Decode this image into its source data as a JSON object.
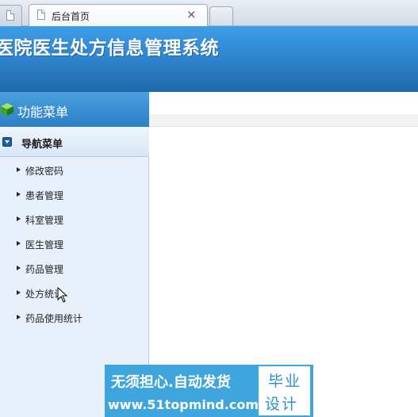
{
  "browser": {
    "tab_title": "后台首页",
    "close_symbol": "×"
  },
  "header": {
    "title": "医院医生处方信息管理系统"
  },
  "sidebar": {
    "heading": "功能菜单",
    "nav_heading": "导航菜单",
    "items": [
      {
        "label": "修改密码"
      },
      {
        "label": "患者管理"
      },
      {
        "label": "科室管理"
      },
      {
        "label": "医生管理"
      },
      {
        "label": "药品管理"
      },
      {
        "label": "处方统计"
      },
      {
        "label": "药品使用统计"
      }
    ]
  },
  "watermark": {
    "line1": "无须担心.自动发货",
    "line2": "www.51topmind.com",
    "badge_line1": "毕业",
    "badge_line2": "设计"
  },
  "colors": {
    "banner": "#2f86d1",
    "sidebar_bg": "#e8f1fb",
    "watermark": "#3ea6dd"
  }
}
